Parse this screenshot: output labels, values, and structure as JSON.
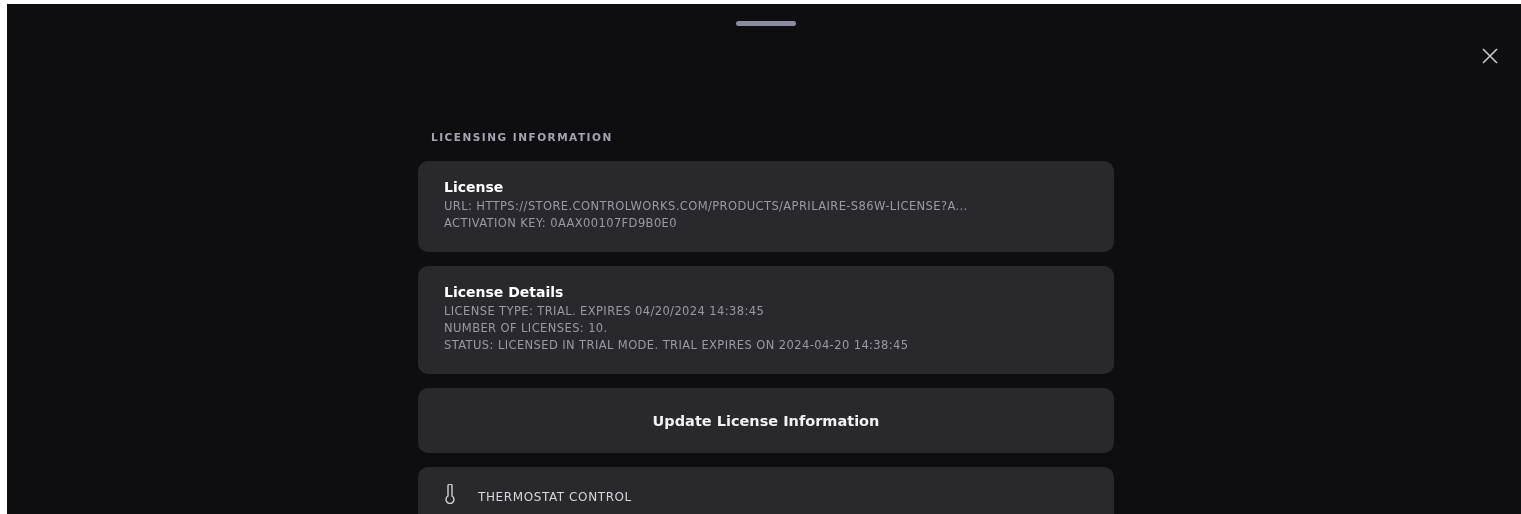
{
  "section_title": "LICENSING INFORMATION",
  "cards": [
    {
      "title": "License",
      "lines": [
        "URL: HTTPS://STORE.CONTROLWORKS.COM/PRODUCTS/APRILAIRE-S86W-LICENSE?A...",
        "ACTIVATION KEY: 0AAX00107FD9B0E0"
      ]
    },
    {
      "title": "License Details",
      "lines": [
        "LICENSE TYPE: TRIAL. EXPIRES 04/20/2024 14:38:45",
        "NUMBER OF LICENSES: 10.",
        "STATUS: LICENSED IN TRIAL MODE. TRIAL EXPIRES ON 2024-04-20 14:38:45"
      ]
    }
  ],
  "update_button": "Update License Information",
  "thermostat_row": {
    "label": "THERMOSTAT CONTROL"
  }
}
